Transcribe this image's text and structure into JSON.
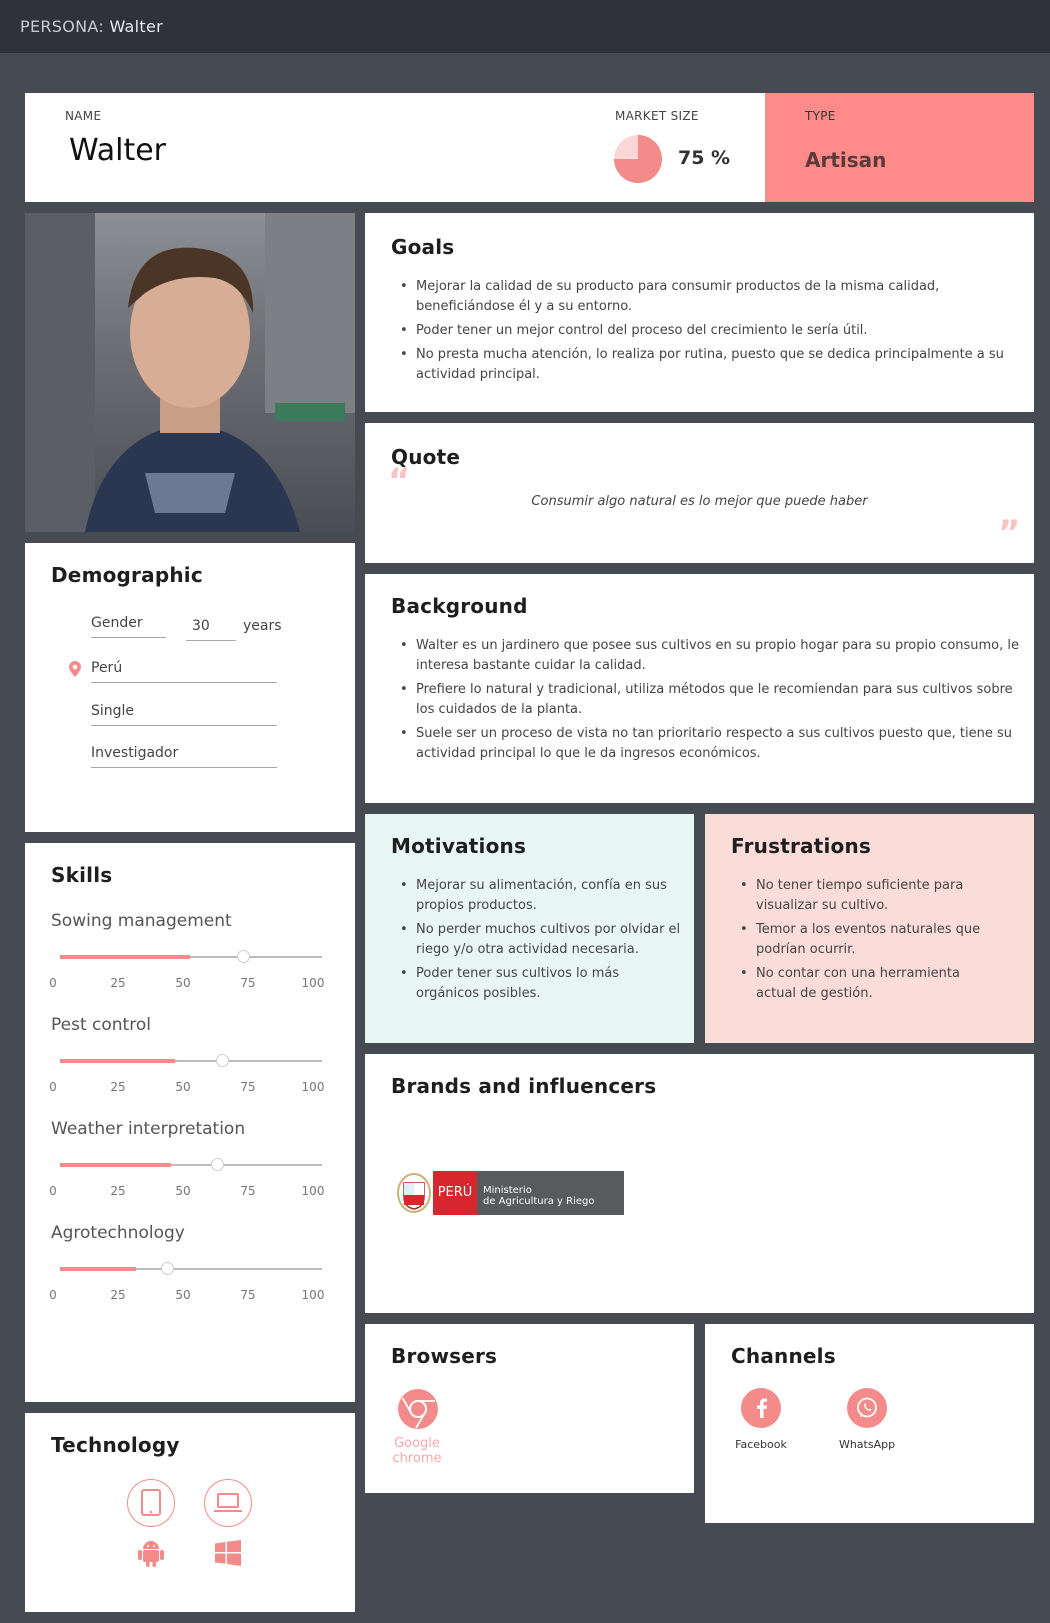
{
  "topbar": {
    "prefix": "PERSONA:",
    "name": "Walter"
  },
  "header": {
    "name_label": "NAME",
    "name": "Walter",
    "market_label": "MARKET SIZE",
    "market_value": "75 %",
    "market_fraction": 0.75,
    "type_label": "TYPE",
    "type": "Artisan"
  },
  "goals": {
    "title": "Goals",
    "items": [
      "Mejorar la calidad de su producto para consumir productos de la misma calidad, beneficiándose él y a su entorno.",
      "Poder tener un mejor control del proceso del crecimiento le sería útil.",
      "No presta mucha atención, lo realiza por rutina, puesto que se dedica principalmente a su actividad principal."
    ]
  },
  "quote": {
    "title": "Quote",
    "text": "Consumir algo natural es lo mejor que puede haber",
    "open_mark": "“",
    "close_mark": "”"
  },
  "background": {
    "title": "Background",
    "items": [
      "Walter es un jardinero que posee sus cultivos en su propio hogar para su propio consumo, le interesa bastante cuidar la calidad.",
      "Prefiere lo natural y tradicional, utiliza métodos que le recomiendan para sus cultivos sobre los cuidados de la planta.",
      "Suele ser un proceso de vista no tan prioritario respecto a sus cultivos puesto que, tiene su actividad principal lo que le da ingresos económicos."
    ]
  },
  "demographic": {
    "title": "Demographic",
    "gender": "Gender",
    "age": "30",
    "age_unit": "years",
    "location": "Perú",
    "status": "Single",
    "occupation": "Investigador"
  },
  "skills": {
    "title": "Skills",
    "tick_labels": [
      "0",
      "25",
      "50",
      "75",
      "100"
    ],
    "items": [
      {
        "name": "Sowing management",
        "value": 70
      },
      {
        "name": "Pest control",
        "value": 62
      },
      {
        "name": "Weather interpretation",
        "value": 60
      },
      {
        "name": "Agrotechnology",
        "value": 41
      }
    ]
  },
  "motivations": {
    "title": "Motivations",
    "items": [
      "Mejorar su alimentación, confía en sus propios productos.",
      "No perder muchos cultivos por olvidar el riego y/o otra actividad necesaria.",
      "Poder tener sus cultivos lo más orgánicos posibles."
    ]
  },
  "frustrations": {
    "title": "Frustrations",
    "items": [
      "No tener tiempo suficiente para visualizar su cultivo.",
      "Temor a los eventos naturales que podrían ocurrir.",
      "No contar con una herramienta actual de gestión."
    ]
  },
  "brands": {
    "title": "Brands and influencers",
    "logo_brand": "PERÚ",
    "logo_line1": "Ministerio",
    "logo_line2": "de Agricultura y Riego"
  },
  "technology": {
    "title": "Technology",
    "icons": [
      "tablet-icon",
      "laptop-icon",
      "android-icon",
      "windows-icon"
    ]
  },
  "browsers": {
    "title": "Browsers",
    "items": [
      {
        "icon": "chrome-icon",
        "label_line1": "Google",
        "label_line2": "chrome"
      }
    ]
  },
  "channels": {
    "title": "Channels",
    "items": [
      {
        "icon": "facebook-icon",
        "label": "Facebook"
      },
      {
        "icon": "whatsapp-icon",
        "label": "WhatsApp"
      }
    ]
  },
  "colors": {
    "accent": "#f48b8b",
    "type_bg": "#ff8a8a",
    "motivations_bg": "#e8f7f4",
    "frustrations_bg": "#fadcd9",
    "background": "#464a53",
    "topbar": "#2f323a"
  }
}
